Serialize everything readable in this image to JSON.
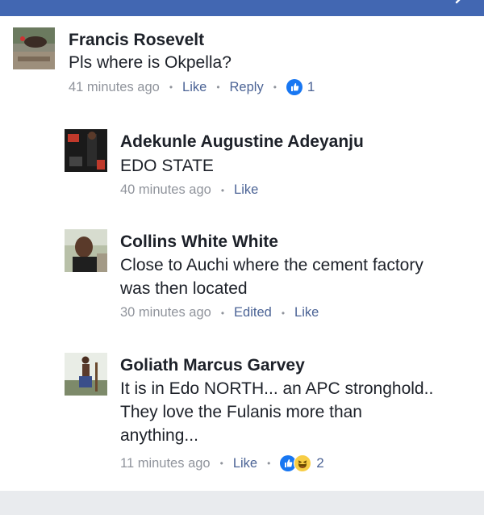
{
  "colors": {
    "header": "#4267b2",
    "link": "#4b6395",
    "meta": "#90949c",
    "name": "#1d2129",
    "like_blue": "#1877f2",
    "haha_yellow": "#f7cd45"
  },
  "comments": [
    {
      "name": "Francis Rosevelt",
      "text": [
        "Pls where is Okpella?"
      ],
      "time": "41 minutes ago",
      "like": "Like",
      "reply": "Reply",
      "reaction_count": "1",
      "reactions": [
        "like-icon"
      ]
    },
    {
      "name": "Adekunle Augustine Adeyanju",
      "text": [
        "EDO STATE"
      ],
      "time": "40 minutes ago",
      "like": "Like"
    },
    {
      "name": "Collins White White",
      "text": [
        "Close to Auchi where the cement factory",
        "was then located"
      ],
      "time": "30 minutes ago",
      "edited": "Edited",
      "like": "Like"
    },
    {
      "name": "Goliath Marcus Garvey",
      "text": [
        "It is in Edo NORTH... an APC stronghold..",
        "They love the Fulanis more than",
        "anything..."
      ],
      "time": "11 minutes ago",
      "like": "Like",
      "reaction_count": "2",
      "reactions": [
        "like-icon",
        "haha-icon"
      ]
    }
  ]
}
